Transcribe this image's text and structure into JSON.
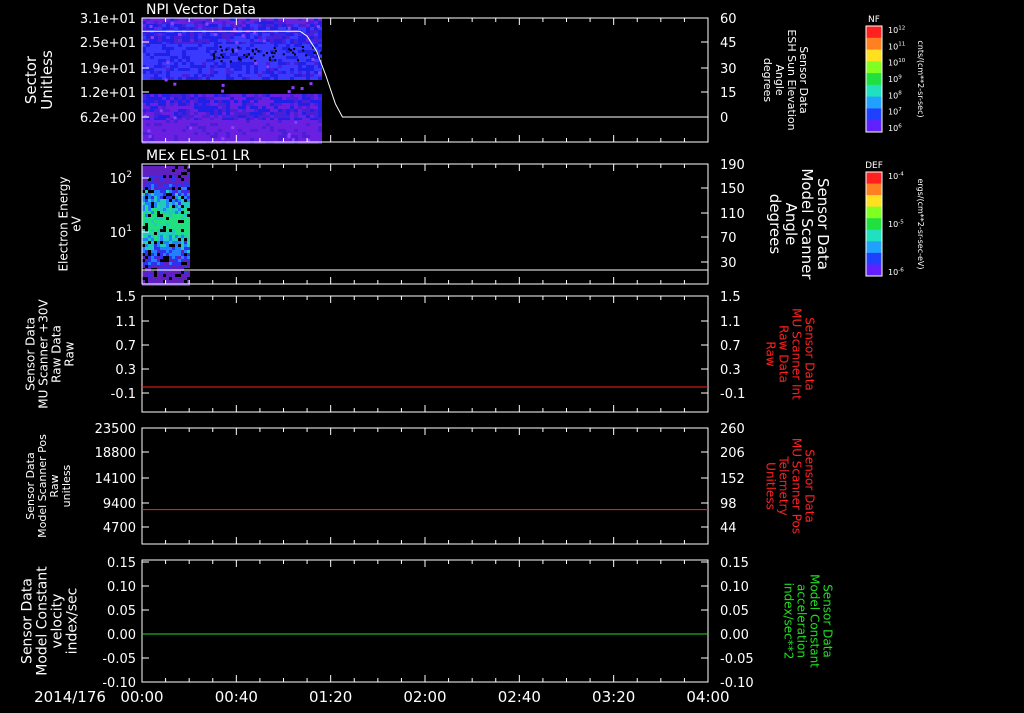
{
  "date_label": "2014/176",
  "time_ticks": [
    "00:00",
    "00:40",
    "01:20",
    "02:00",
    "02:40",
    "03:20",
    "04:00"
  ],
  "panels": [
    {
      "title": "NPI Vector Data",
      "left_label": [
        "Sector",
        "Unitless"
      ],
      "left_ticks": [
        "3.1e+01",
        "2.5e+01",
        "1.9e+01",
        "1.2e+01",
        "6.2e+00"
      ],
      "right_label": [
        "Sensor Data",
        "ESH Sun Elevation",
        "Angle",
        "degrees"
      ],
      "right_ticks": [
        "60",
        "45",
        "30",
        "15",
        "0"
      ]
    },
    {
      "title": "MEx ELS-01 LR",
      "left_label": [
        "Electron Energy",
        "eV"
      ],
      "left_ticks": [
        "10",
        "10"
      ],
      "left_tick_exps": [
        "2",
        "1"
      ],
      "right_label": [
        "Sensor Data",
        "Model Scanner",
        "Angle",
        "degrees"
      ],
      "right_ticks": [
        "190",
        "150",
        "110",
        "70",
        "30"
      ]
    },
    {
      "title": "",
      "left_label": [
        "Sensor Data",
        "MU Scanner +30V",
        "Raw Data",
        "Raw"
      ],
      "left_ticks": [
        "1.5",
        "1.1",
        "0.7",
        "0.3",
        "-0.1"
      ],
      "right_label": [
        "Sensor Data",
        "MU Scanner Int",
        "Raw Data",
        "Raw"
      ],
      "right_ticks": [
        "1.5",
        "1.1",
        "0.7",
        "0.3",
        "-0.1"
      ]
    },
    {
      "title": "",
      "left_label": [
        "Sensor Data",
        "Model Scanner Pos",
        "Raw",
        "unitless"
      ],
      "left_ticks": [
        "23500",
        "18800",
        "14100",
        "9400",
        "4700"
      ],
      "right_label": [
        "Sensor Data",
        "MU Scanner Pos",
        "Telemetry",
        "Unitless"
      ],
      "right_ticks": [
        "260",
        "206",
        "152",
        "98",
        "44"
      ]
    },
    {
      "title": "",
      "left_label": [
        "Sensor Data",
        "Model Constant",
        "velocity",
        "index/sec"
      ],
      "left_ticks": [
        "0.15",
        "0.10",
        "0.05",
        "0.00",
        "-0.05",
        "-0.10"
      ],
      "right_label": [
        "Sensor Data",
        "Model Constant",
        "acceleration",
        "index/sec**2"
      ],
      "right_ticks": [
        "0.15",
        "0.10",
        "0.05",
        "0.00",
        "-0.05",
        "-0.10"
      ]
    }
  ],
  "colorbars": [
    {
      "label": "NF",
      "unit": "cnts/(cm**2-sr-sec)",
      "ticks": [
        "10",
        "10",
        "10",
        "10",
        "10",
        "10",
        "10"
      ],
      "tick_exps": [
        "12",
        "11",
        "10",
        "9",
        "8",
        "7",
        "6"
      ]
    },
    {
      "label": "DEF",
      "unit": "ergs/(cm**2-sr-sec-eV)",
      "ticks": [
        "10",
        "10",
        "10"
      ],
      "tick_exps": [
        "-4",
        "-5",
        "-6"
      ]
    }
  ],
  "colors": {
    "background": "#000000",
    "axes": "#ffffff",
    "red_trace": "#ff2020",
    "green_trace": "#22dd22"
  },
  "chart_data": [
    {
      "type": "heatmap",
      "title": "NPI Vector Data",
      "x_range": [
        "00:00",
        "04:00"
      ],
      "ylabel": "Sector Unitless",
      "data_extent": [
        "00:00",
        "01:17"
      ],
      "colorbar": "NF",
      "overlay_line": {
        "ylabel": "Sensor Data ESH Sun Elevation Angle degrees",
        "y_range": [
          -6,
          60
        ],
        "x": [
          "00:00",
          "01:07",
          "01:10",
          "01:14",
          "01:18",
          "01:22",
          "01:25",
          "04:00"
        ],
        "y": [
          52,
          52,
          49,
          40,
          25,
          8,
          0,
          0
        ]
      }
    },
    {
      "type": "heatmap",
      "title": "MEx ELS-01 LR",
      "x_range": [
        "00:00",
        "04:00"
      ],
      "ylabel": "Electron Energy eV",
      "yscale": "log",
      "data_extent": [
        "00:00",
        "00:20"
      ],
      "colorbar": "DEF",
      "overlay_line": {
        "ylabel": "Sensor Data Model Scanner Angle degrees",
        "y_range": [
          5,
          190
        ],
        "x": [
          "00:00",
          "04:00"
        ],
        "y": [
          17,
          17
        ]
      }
    },
    {
      "type": "line",
      "x_range": [
        "00:00",
        "04:00"
      ],
      "y_range": [
        -0.35,
        1.5
      ],
      "series": [
        {
          "x": [
            "00:00",
            "04:00"
          ],
          "y": [
            0.0,
            0.0
          ],
          "color": "#ff2020"
        }
      ]
    },
    {
      "type": "line",
      "x_range": [
        "00:00",
        "04:00"
      ],
      "y_range": [
        0,
        23500
      ],
      "series": [
        {
          "x": [
            "00:00",
            "04:00"
          ],
          "y": [
            8000,
            8000
          ],
          "color": "#ff2020"
        }
      ]
    },
    {
      "type": "line",
      "x_range": [
        "00:00",
        "04:00"
      ],
      "y_range": [
        -0.1,
        0.15
      ],
      "series": [
        {
          "x": [
            "00:00",
            "04:00"
          ],
          "y": [
            0.0,
            0.0
          ],
          "color": "#22dd22"
        }
      ]
    }
  ]
}
